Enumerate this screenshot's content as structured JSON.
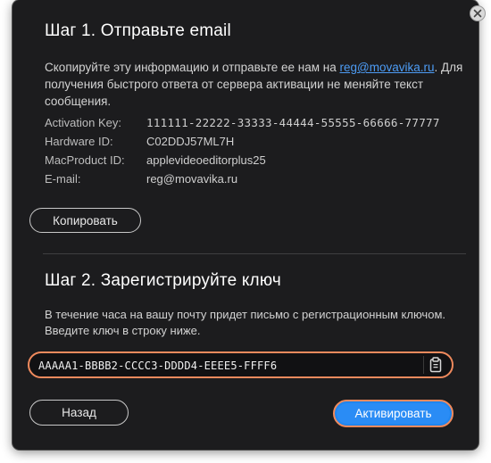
{
  "step1": {
    "title": "Шаг 1. Отправьте email",
    "desc_before": "Скопируйте эту информацию и отправьте ее нам на ",
    "email_link": "reg@movavika.ru",
    "desc_after": ". Для получения быстрого ответа от сервера активации не меняйте текст сообщения.",
    "rows": [
      {
        "label": "Activation Key:",
        "value": "111111-22222-33333-44444-55555-66666-77777"
      },
      {
        "label": "Hardware ID:",
        "value": "C02DDJ57ML7H"
      },
      {
        "label": "MacProduct ID:",
        "value": "applevideoeditorplus25"
      },
      {
        "label": "E-mail:",
        "value": "reg@movavika.ru"
      }
    ],
    "copy_button": "Копировать"
  },
  "step2": {
    "title": "Шаг 2. Зарегистрируйте ключ",
    "desc": "В течение часа на вашу почту придет письмо с регистрационным ключом. Введите ключ в строку ниже.",
    "key_value": "AAAAA1-BBBB2-CCCC3-DDDD4-EEEE5-FFFF6"
  },
  "footer": {
    "back_button": "Назад",
    "activate_button": "Активировать"
  },
  "icons": {
    "close": "close-icon",
    "paste": "clipboard-icon"
  },
  "colors": {
    "background": "#1c1c1e",
    "accent": "#2a8cf5",
    "focus_ring": "#f08a5d",
    "link": "#4d9cf5"
  }
}
